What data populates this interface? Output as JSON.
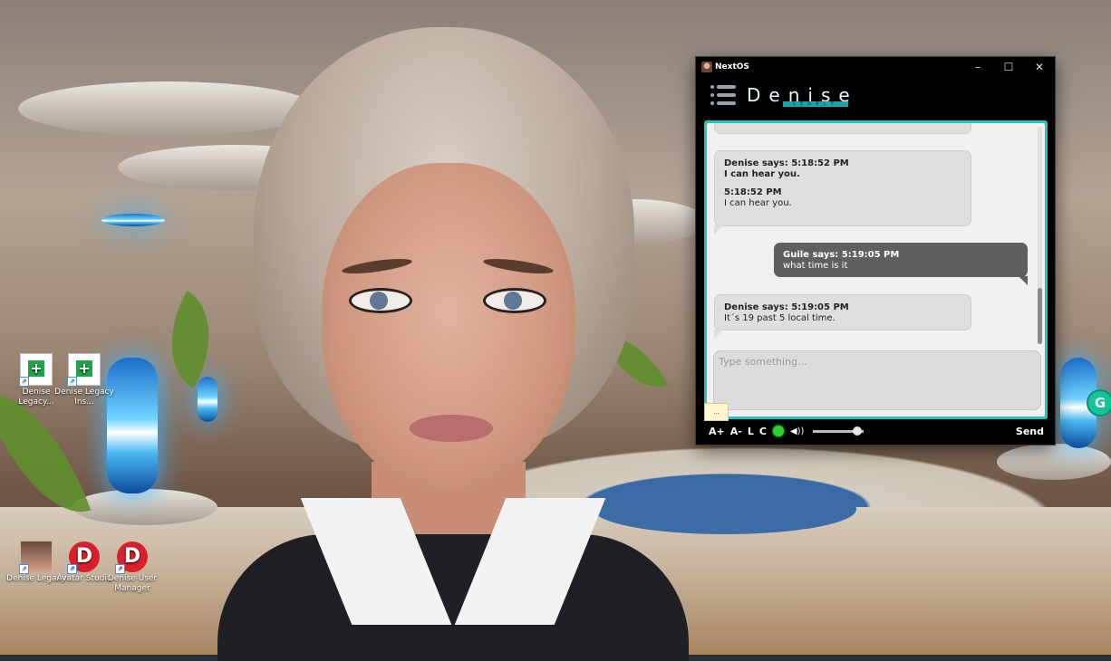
{
  "desktop": {
    "icons": [
      {
        "id": "denise-legacy-installer-1",
        "label": "Denise Legacy...",
        "icon": "setup-file-icon"
      },
      {
        "id": "denise-legacy-installer-2",
        "label": "Denise Legacy Ins...",
        "icon": "setup-file-icon"
      },
      {
        "id": "denise-legacy",
        "label": "Denise Legacy",
        "icon": "avatar-portrait-icon"
      },
      {
        "id": "avatar-studio",
        "label": "Avatar Studio",
        "icon": "red-d-logo-icon"
      },
      {
        "id": "denise-user-manager",
        "label": "Denise User Manager",
        "icon": "red-d-logo-icon"
      }
    ],
    "grammarly_badge": "G"
  },
  "window": {
    "title": "NextOS",
    "controls": {
      "minimize": "–",
      "maximize": "☐",
      "close": "✕"
    },
    "logo_word": "Denise",
    "logo_tag": "LEGACY",
    "chat": {
      "messages": [
        {
          "from": "Denise",
          "header": "Denise says: 5:18:52 PM",
          "text": "I can hear you.",
          "extra_time": "5:18:52 PM",
          "extra_text": "I can hear you."
        },
        {
          "from": "Guile",
          "header": "Guile says: 5:19:05 PM",
          "text": "what time is it"
        },
        {
          "from": "Denise",
          "header": "Denise says: 5:19:05 PM",
          "text": "It´s 19 past 5 local time."
        }
      ],
      "input_placeholder": "Type something...",
      "flag_label": "..."
    },
    "toolbar": {
      "font_up": "A+",
      "font_down": "A-",
      "l_button": "L",
      "c_button": "C",
      "mic_status_color": "#2ed12e",
      "speaker_symbol": "◀))",
      "volume_level": 0.8,
      "send_label": "Send"
    },
    "accent_color": "#29c3bf"
  }
}
